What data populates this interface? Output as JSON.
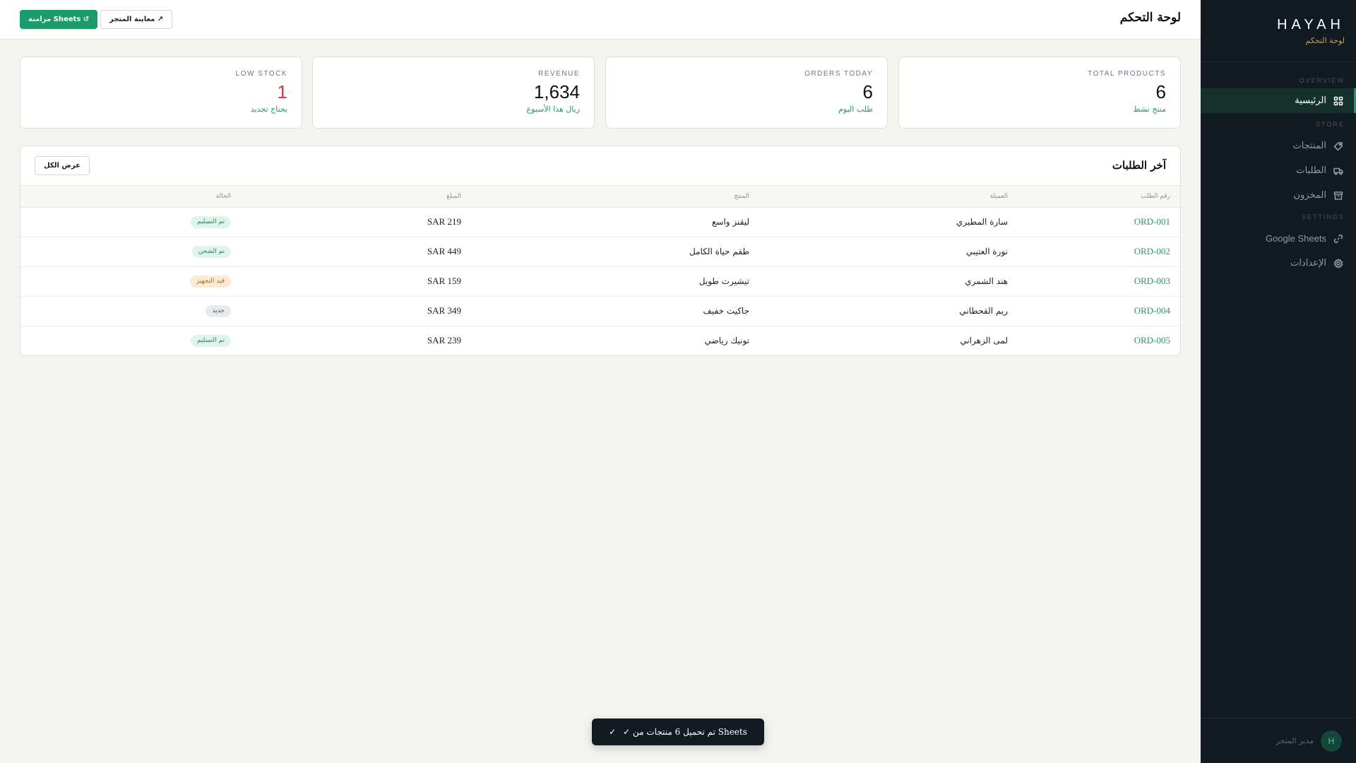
{
  "sidebar": {
    "brand_name": "HAYAH",
    "brand_sub": "لوحة التحكم",
    "sections": {
      "overview": "OVERVIEW",
      "store": "STORE",
      "settings": "SETTINGS"
    },
    "items": {
      "home": {
        "label": "الرئيسية",
        "icon": "grid-icon",
        "active": true
      },
      "products": {
        "label": "المنتجات",
        "icon": "tag-icon"
      },
      "orders": {
        "label": "الطلبات",
        "icon": "truck-icon"
      },
      "inventory": {
        "label": "المخزون",
        "icon": "archive-icon"
      },
      "sheets": {
        "label": "Google Sheets",
        "icon": "link-icon"
      },
      "settings": {
        "label": "الإعدادات",
        "icon": "gear-icon"
      }
    },
    "footer": {
      "avatar": "H",
      "name": "مدير المتجر"
    }
  },
  "header": {
    "title": "لوحة التحكم",
    "sync_label": "مزامنة Sheets ↺",
    "preview_label": "معاينة المتجر ↗"
  },
  "stats": {
    "total_products": {
      "label": "TOTAL PRODUCTS",
      "value": "6",
      "sub": "منتج نشط"
    },
    "orders_today": {
      "label": "ORDERS TODAY",
      "value": "6",
      "sub": "طلب اليوم"
    },
    "revenue": {
      "label": "REVENUE",
      "value": "1,634",
      "sub": "ريال هذا الأسبوع"
    },
    "low_stock": {
      "label": "LOW STOCK",
      "value": "1",
      "sub": "يحتاج تجديد"
    }
  },
  "orders": {
    "title": "آخر الطلبات",
    "view_all": "عرض الكل",
    "columns": [
      "رقم الطلب",
      "العميلة",
      "المنتج",
      "المبلغ",
      "الحالة"
    ],
    "rows": [
      {
        "id": "ORD-001",
        "customer": "سارة المطيري",
        "product": "ليقنز واسع",
        "amount": "SAR 219",
        "status": "تم التسليم",
        "status_kind": "green"
      },
      {
        "id": "ORD-002",
        "customer": "نورة العتيبي",
        "product": "طقم حياة الكامل",
        "amount": "SAR 449",
        "status": "تم الشحن",
        "status_kind": "green"
      },
      {
        "id": "ORD-003",
        "customer": "هند الشمري",
        "product": "تيشيرت طويل",
        "amount": "SAR 159",
        "status": "قيد التجهيز",
        "status_kind": "orange"
      },
      {
        "id": "ORD-004",
        "customer": "ريم القحطاني",
        "product": "جاكيت خفيف",
        "amount": "SAR 349",
        "status": "جديد",
        "status_kind": "gray"
      },
      {
        "id": "ORD-005",
        "customer": "لمى الزهراني",
        "product": "تونيك رياضي",
        "amount": "SAR 239",
        "status": "تم التسليم",
        "status_kind": "green"
      }
    ]
  },
  "toast": {
    "text": "✓ تم تحميل 6 منتجات من Sheets",
    "check": "✓"
  },
  "colors": {
    "accent": "#1e9b6d",
    "sidebar_bg": "#111a21",
    "danger": "#e0353a"
  }
}
